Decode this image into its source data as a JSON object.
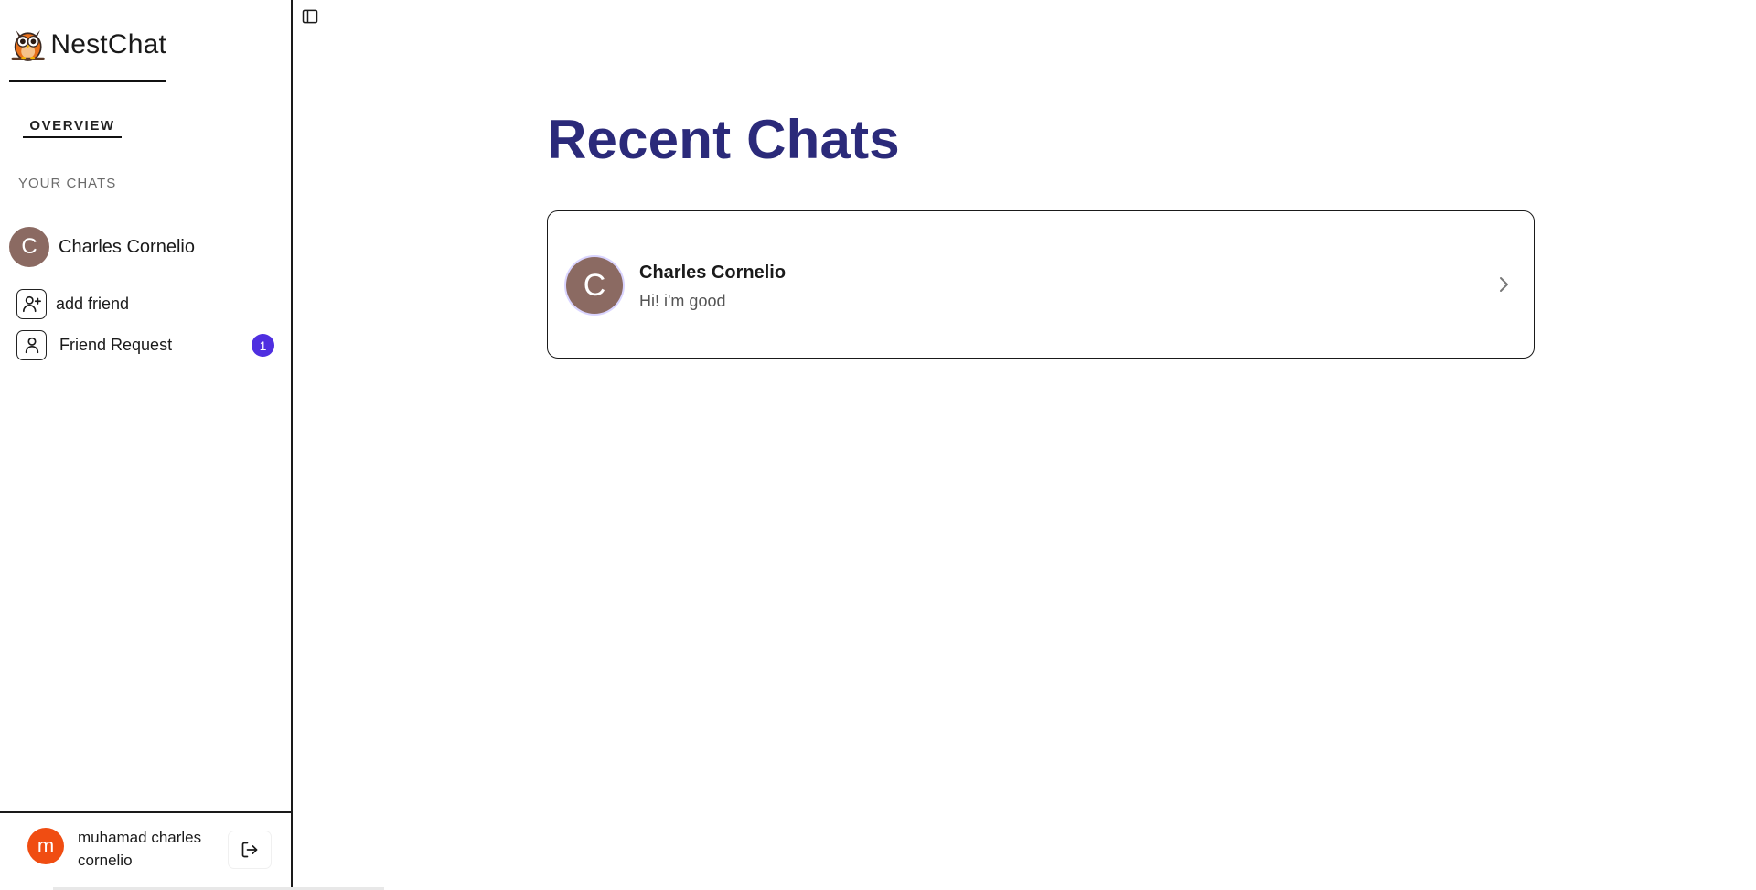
{
  "brand": {
    "name": "NestChat"
  },
  "sidebar": {
    "overview_label": "OVERVIEW",
    "section_label": "YOUR CHATS",
    "chats": [
      {
        "initial": "C",
        "name": "Charles Cornelio",
        "avatar_color": "#8b6a62"
      }
    ],
    "nav": {
      "add_friend": "add friend",
      "friend_request": "Friend Request",
      "friend_request_count": "1"
    }
  },
  "profile": {
    "initial": "m",
    "name": "muhamad charles cornelio",
    "avatar_color": "#f04d12"
  },
  "main": {
    "title": "Recent Chats",
    "recent_chats": [
      {
        "initial": "C",
        "name": "Charles Cornelio",
        "last_message": "Hi! i'm good",
        "avatar_color": "#8b6a62"
      }
    ]
  },
  "colors": {
    "title": "#2b2a7a",
    "badge": "#4f2fe0"
  }
}
